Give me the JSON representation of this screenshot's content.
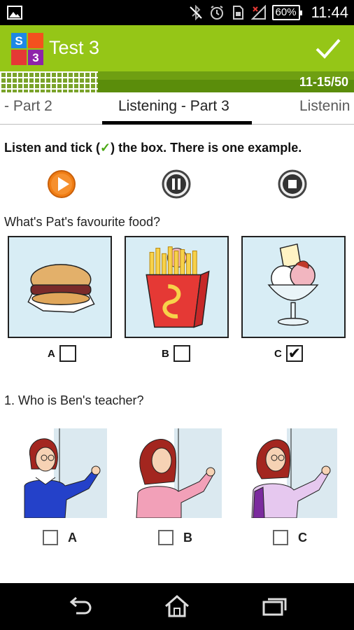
{
  "status_bar": {
    "battery": "60%",
    "time": "11:44"
  },
  "app_bar": {
    "logo_letters": [
      "S",
      "3"
    ],
    "title": "Test 3"
  },
  "progress": {
    "label": "11-15/50"
  },
  "tabs": {
    "previous": "- Part 2",
    "current": "Listening - Part 3",
    "next": "Listenin"
  },
  "instruction": {
    "before": "Listen and tick (",
    "mark": "✓",
    "after": ") the box. There is one example."
  },
  "example": {
    "question": "What's Pat's favourite food?",
    "options": [
      {
        "label": "A",
        "checked": false
      },
      {
        "label": "B",
        "checked": false
      },
      {
        "label": "C",
        "checked": true,
        "mark": "✔"
      }
    ]
  },
  "question_1": {
    "question": "1. Who is Ben's teacher?",
    "options": [
      {
        "label": "A"
      },
      {
        "label": "B"
      },
      {
        "label": "C"
      }
    ]
  },
  "colors": {
    "app_bar": "#95c617",
    "progress_bar": "#5b8d0b",
    "play_accent": "#f07d14"
  }
}
